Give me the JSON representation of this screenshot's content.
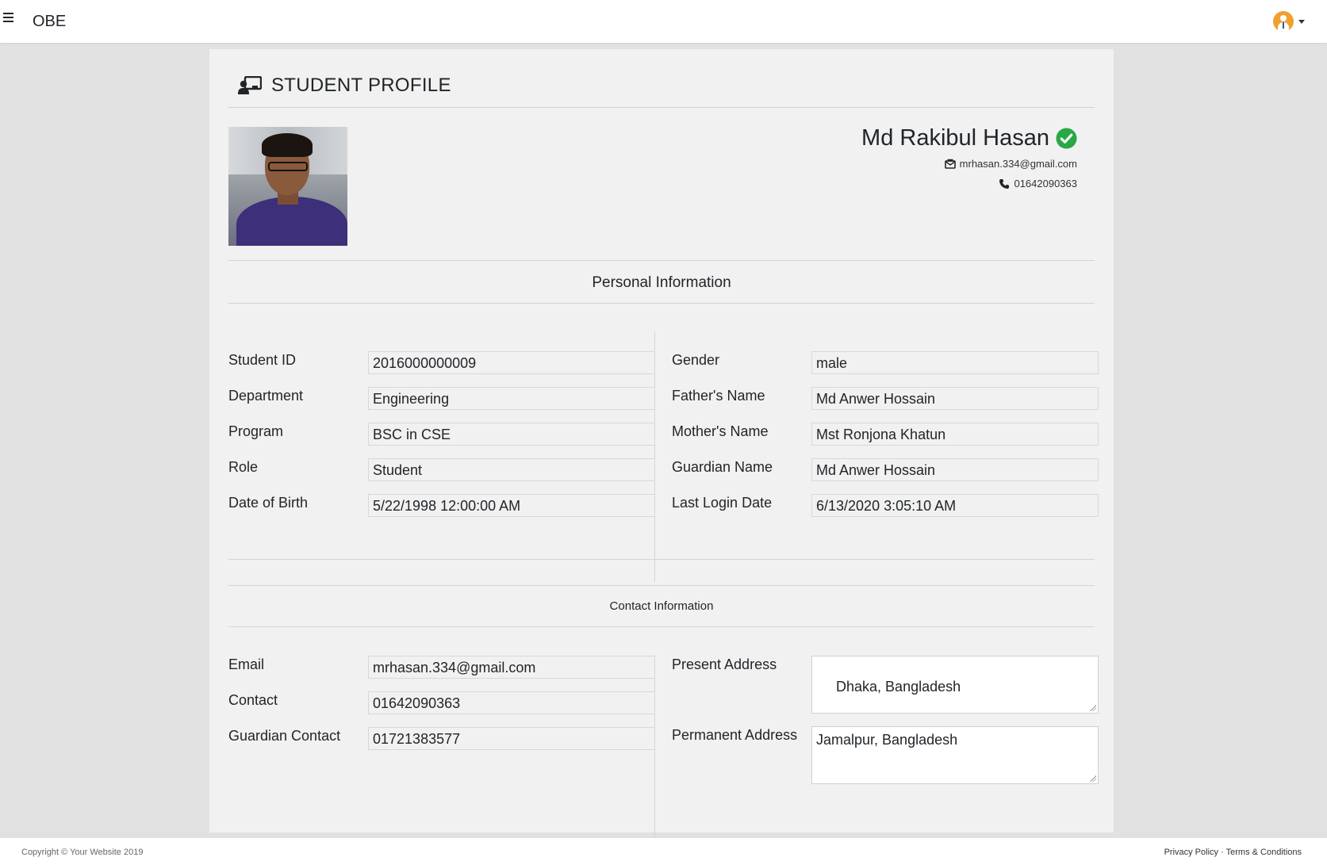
{
  "app": {
    "brand": "OBE"
  },
  "page": {
    "title": "STUDENT PROFILE"
  },
  "profile": {
    "name": "Md Rakibul Hasan",
    "email": "mrhasan.334@gmail.com",
    "phone": "01642090363"
  },
  "personal": {
    "title": "Personal Information",
    "left": [
      {
        "label": "Student ID",
        "value": "2016000000009"
      },
      {
        "label": "Department",
        "value": "Engineering"
      },
      {
        "label": "Program",
        "value": "BSC in CSE"
      },
      {
        "label": "Role",
        "value": "Student"
      },
      {
        "label": "Date of Birth",
        "value": "5/22/1998 12:00:00 AM"
      }
    ],
    "right": [
      {
        "label": "Gender",
        "value": "male"
      },
      {
        "label": "Father's Name",
        "value": "Md Anwer Hossain"
      },
      {
        "label": "Mother's Name",
        "value": "Mst Ronjona Khatun"
      },
      {
        "label": "Guardian Name",
        "value": "Md Anwer Hossain"
      },
      {
        "label": "Last Login Date",
        "value": "6/13/2020 3:05:10 AM"
      }
    ]
  },
  "contact": {
    "title": "Contact Information",
    "left": [
      {
        "label": "Email",
        "value": "mrhasan.334@gmail.com"
      },
      {
        "label": "Contact",
        "value": "01642090363"
      },
      {
        "label": "Guardian Contact",
        "value": "01721383577"
      }
    ],
    "present_address": {
      "label": "Present Address",
      "value": " Dhaka, Bangladesh"
    },
    "permanent_address": {
      "label": "Permanent Address",
      "value": "Jamalpur, Bangladesh"
    }
  },
  "footer": {
    "copyright": "Copyright © Your Website 2019",
    "privacy": "Privacy Policy",
    "separator": "·",
    "terms": "Terms & Conditions"
  },
  "colors": {
    "verified": "#28a745",
    "avatar": "#f0a030"
  }
}
